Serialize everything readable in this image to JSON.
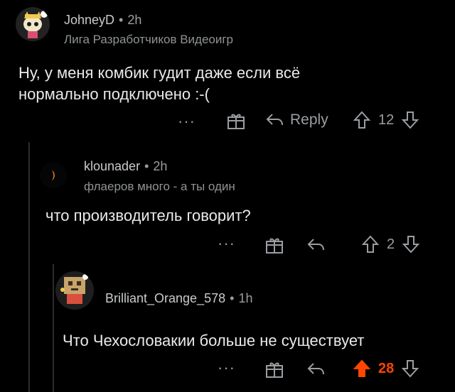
{
  "colors": {
    "background": "#000000",
    "text": "#e8eaec",
    "muted": "#9a9ea2",
    "upvote_active": "#ff4500"
  },
  "comments": [
    {
      "username": "JohneyD",
      "separator": "•",
      "time": "2h",
      "flair": "Лига Разработчиков Видеоигр",
      "text_line1": "Ну, у меня комбик гудит даже если всё",
      "text_line2": "нормально подключено :-(",
      "more": "···",
      "reply_label": "Reply",
      "votes": "12",
      "upvoted": false
    },
    {
      "username": "klounader",
      "separator": "•",
      "time": "2h",
      "flair": "флаеров много - а ты один",
      "text_line1": "что производитель говорит?",
      "more": "···",
      "votes": "2",
      "upvoted": false
    },
    {
      "username": "Brilliant_Orange_578",
      "separator": "•",
      "time": "1h",
      "text_line1": "Что Чехословакии больше не существует",
      "more": "···",
      "votes": "28",
      "upvoted": true
    }
  ],
  "icons": {
    "more": "more-options-icon",
    "award": "award-gift-icon",
    "reply": "reply-arrow-icon",
    "upvote": "upvote-arrow-icon",
    "downvote": "downvote-arrow-icon"
  }
}
